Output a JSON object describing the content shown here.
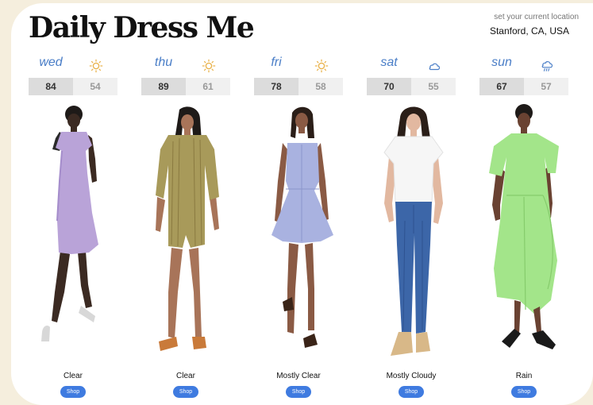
{
  "app": {
    "title": "Daily Dress Me"
  },
  "location": {
    "label": "set your current location",
    "value": "Stanford, CA, USA"
  },
  "days": [
    {
      "day": "wed",
      "high": "84",
      "low": "54",
      "icon": "sun-icon",
      "condition": "Clear",
      "shop": "Shop"
    },
    {
      "day": "thu",
      "high": "89",
      "low": "61",
      "icon": "sun-icon",
      "condition": "Clear",
      "shop": "Shop"
    },
    {
      "day": "fri",
      "high": "78",
      "low": "58",
      "icon": "sun-icon",
      "condition": "Mostly Clear",
      "shop": "Shop"
    },
    {
      "day": "sat",
      "high": "70",
      "low": "55",
      "icon": "cloud-icon",
      "condition": "Mostly Cloudy",
      "shop": "Shop"
    },
    {
      "day": "sun",
      "high": "67",
      "low": "57",
      "icon": "rain-cloud-icon",
      "condition": "Rain",
      "shop": "Shop"
    }
  ],
  "colors": {
    "accent": "#4a7ec7",
    "button": "#3f7be0",
    "background": "#f5eedd"
  }
}
